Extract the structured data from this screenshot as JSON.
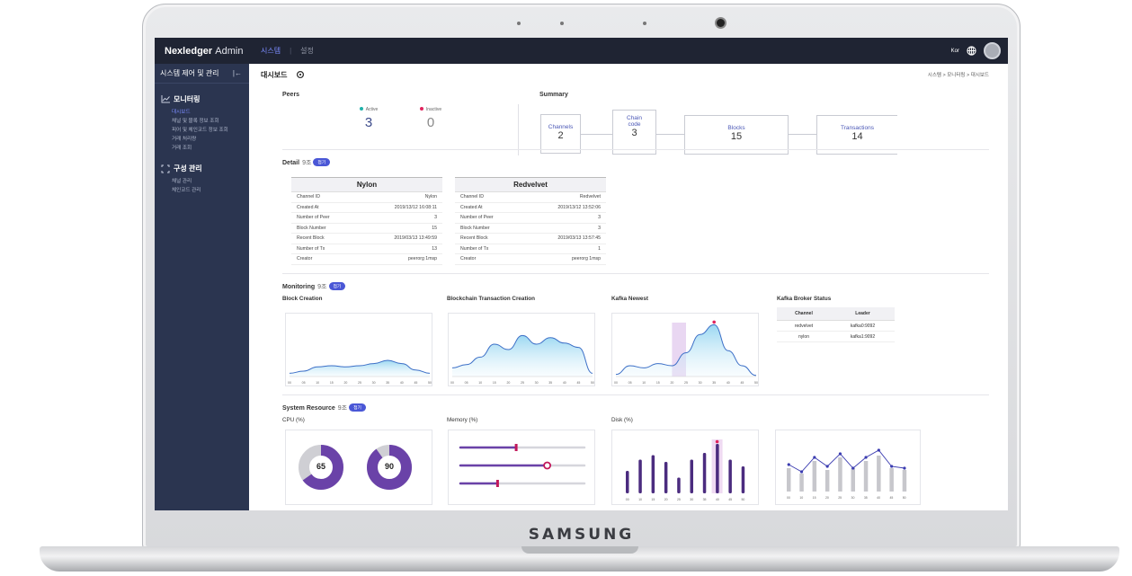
{
  "device": {
    "brand": "SAMSUNG"
  },
  "header": {
    "app_name": "Nexledger",
    "app_suffix": "Admin",
    "nav": [
      {
        "label": "시스템"
      },
      {
        "label": "설정"
      }
    ],
    "lang": "Kor"
  },
  "sidebar": {
    "title": "시스템 제어 및 관리",
    "collapse": "|←",
    "sections": [
      {
        "label": "모니터링",
        "items": [
          "대시보드",
          "채널 및 블록 정보 조회",
          "피어 및 체인코드 정보 조회",
          "거래 처리량",
          "거래 조회"
        ]
      },
      {
        "label": "구성 관리",
        "items": [
          "채널 관리",
          "체인코드 관리"
        ]
      }
    ]
  },
  "page": {
    "title": "대시보드",
    "breadcrumb": "시스템 > 모니터링 > 대시보드"
  },
  "peers": {
    "label": "Peers",
    "active_label": "Active",
    "active": "3",
    "inactive_label": "Inactive",
    "inactive": "0",
    "active_color": "#20b2aa",
    "inactive_color": "#e0245e"
  },
  "summary": {
    "label": "Summary",
    "boxes": [
      {
        "label": "Channels",
        "value": "2"
      },
      {
        "label": "Chain code",
        "value": "3"
      },
      {
        "label": "Blocks",
        "value": "15"
      },
      {
        "label": "Transactions",
        "value": "14"
      }
    ]
  },
  "detail": {
    "label": "Detail",
    "count": "9조",
    "pill": "접기",
    "cards": [
      {
        "name": "Nylon",
        "rows": [
          {
            "k": "Channel ID",
            "v": "Nylon"
          },
          {
            "k": "Created At",
            "v": "2019/13/12 16:08:11"
          },
          {
            "k": "Number of Peer",
            "v": "3"
          },
          {
            "k": "Block Number",
            "v": "15"
          },
          {
            "k": "Recent Block",
            "v": "2019/03/13 13:49:59"
          },
          {
            "k": "Number of Tx",
            "v": "13"
          },
          {
            "k": "Creator",
            "v": "peerorg 1msp"
          }
        ]
      },
      {
        "name": "Redvelvet",
        "rows": [
          {
            "k": "Channel ID",
            "v": "Redvelvet"
          },
          {
            "k": "Created At",
            "v": "2019/13/12 13:52:06"
          },
          {
            "k": "Number of Peer",
            "v": "3"
          },
          {
            "k": "Block Number",
            "v": "3"
          },
          {
            "k": "Recent Block",
            "v": "2019/03/13 13:57:45"
          },
          {
            "k": "Number of Tx",
            "v": "1"
          },
          {
            "k": "Creator",
            "v": "peerorg 1msp"
          }
        ]
      }
    ]
  },
  "monitoring": {
    "label": "Monitoring",
    "count": "9조",
    "pill": "접기",
    "charts": [
      {
        "title": "Block Creation"
      },
      {
        "title": "Blockchain Transaction Creation"
      },
      {
        "title": "Kafka Newest"
      }
    ],
    "broker": {
      "title": "Kafka Broker Status",
      "headers": [
        "Channel",
        "Leader"
      ],
      "rows": [
        [
          "redvelvet",
          "kafka0:9092"
        ],
        [
          "nylon",
          "kafka1:9092"
        ]
      ]
    }
  },
  "system_resource": {
    "label": "System Resource",
    "count": "9조",
    "pill": "접기",
    "cpu": {
      "title": "CPU (%)",
      "values": [
        "65",
        "90"
      ]
    },
    "memory": {
      "title": "Memory (%)",
      "levels": [
        0.45,
        0.7,
        0.3
      ]
    },
    "disk": {
      "title": "Disk (%)"
    }
  },
  "chart_data": [
    {
      "type": "area",
      "x": [
        0,
        5,
        10,
        15,
        20,
        25,
        30,
        35,
        40,
        45,
        50
      ],
      "series": [
        {
          "values": [
            3,
            5,
            9,
            10,
            9,
            10,
            12,
            15,
            12,
            6,
            3
          ]
        },
        {
          "values": [
            8,
            11,
            18,
            30,
            25,
            38,
            30,
            36,
            31,
            27,
            3
          ]
        },
        {
          "values": [
            2,
            10,
            8,
            12,
            10,
            22,
            39,
            48,
            24,
            10,
            1
          ]
        }
      ]
    },
    {
      "type": "pie",
      "series": [
        {
          "values": [
            65,
            35
          ]
        },
        {
          "values": [
            90,
            10
          ]
        }
      ]
    },
    {
      "type": "bar",
      "categories": [
        "00",
        "10",
        "15",
        "20",
        "25",
        "30",
        "35",
        "40",
        "45",
        "50"
      ],
      "values": [
        20,
        30,
        34,
        28,
        14,
        30,
        36,
        44,
        30,
        24
      ],
      "highlight_index": 7
    },
    {
      "type": "line",
      "categories": [
        "00",
        "10",
        "15",
        "20",
        "25",
        "30",
        "35",
        "40",
        "45",
        "50"
      ],
      "series": [
        {
          "type": "bar",
          "values": [
            26,
            20,
            34,
            24,
            38,
            26,
            34,
            40,
            26,
            24
          ]
        },
        {
          "type": "line",
          "values": [
            30,
            22,
            38,
            28,
            42,
            26,
            38,
            46,
            28,
            26
          ]
        }
      ]
    }
  ]
}
